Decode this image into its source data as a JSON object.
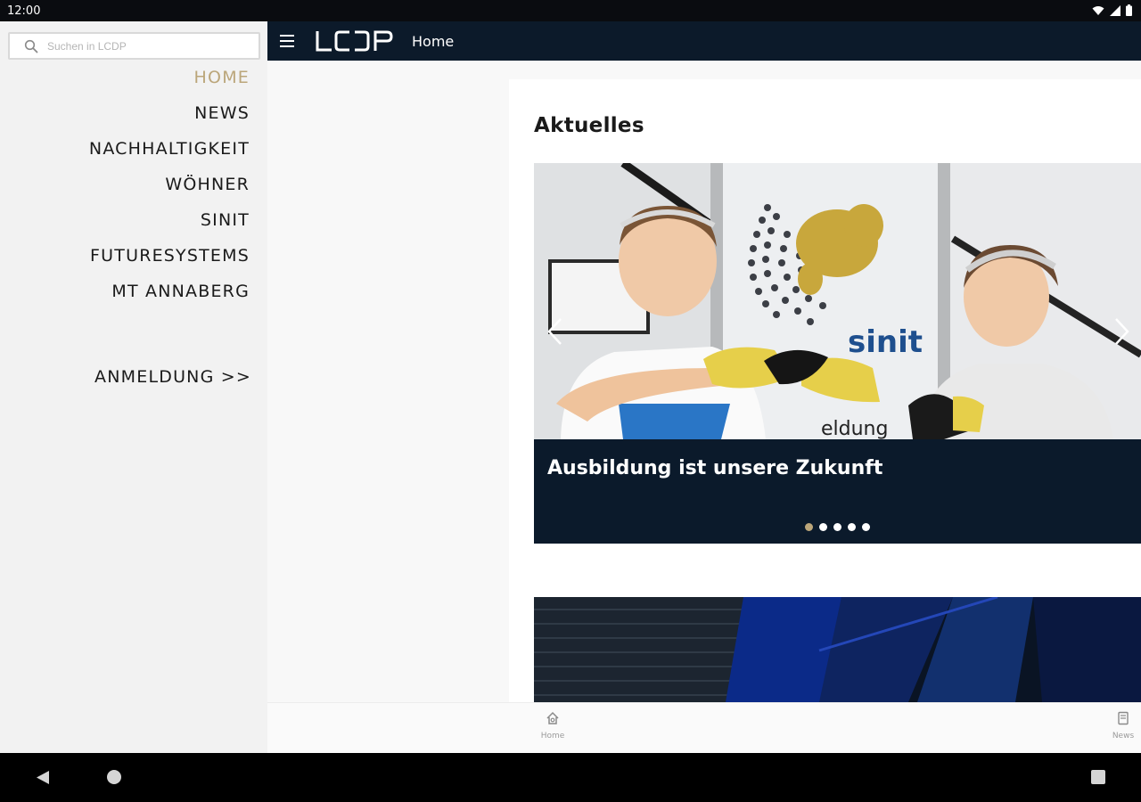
{
  "status_bar": {
    "time": "12:00",
    "icons": [
      "wifi-icon",
      "signal-icon",
      "battery-icon"
    ]
  },
  "drawer": {
    "search": {
      "placeholder": "Suchen in LCDP"
    },
    "items": [
      {
        "label": "HOME",
        "active": true
      },
      {
        "label": "NEWS",
        "active": false
      },
      {
        "label": "NACHHALTIGKEIT",
        "active": false
      },
      {
        "label": "WÖHNER",
        "active": false
      },
      {
        "label": "SINIT",
        "active": false
      },
      {
        "label": "FUTURESYSTEMS",
        "active": false
      },
      {
        "label": "MT ANNABERG",
        "active": false
      }
    ],
    "login_label": "ANMELDUNG >>"
  },
  "app_bar": {
    "logo_text": "LCDP",
    "title": "Home"
  },
  "main": {
    "section_title": "Aktuelles",
    "carousel": {
      "slide_title": "Ausbildung ist unsere Zukunft",
      "image_text": "sinit",
      "image_text_partial": "eldung",
      "slide_count": 5,
      "active_index": 0
    }
  },
  "bottom_tabs": {
    "home_label": "Home",
    "news_label": "News"
  },
  "colors": {
    "accent": "#bba67a",
    "navy": "#0c1a2a",
    "drawer_bg": "#f2f2f2"
  }
}
